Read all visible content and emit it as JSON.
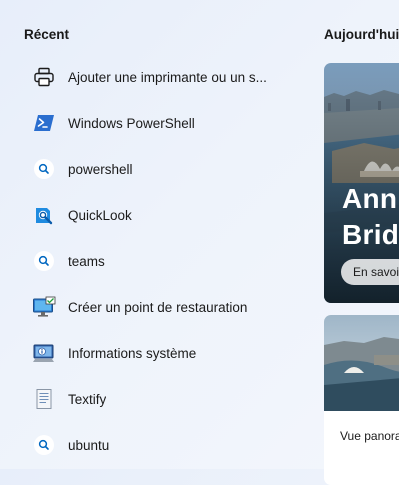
{
  "recent": {
    "title": "Récent",
    "items": [
      {
        "label": "Ajouter une imprimante ou un s...",
        "icon": "printer-icon"
      },
      {
        "label": "Windows PowerShell",
        "icon": "powershell-icon"
      },
      {
        "label": "powershell",
        "icon": "search-icon"
      },
      {
        "label": "QuickLook",
        "icon": "quicklook-icon"
      },
      {
        "label": "teams",
        "icon": "search-icon"
      },
      {
        "label": "Créer un point de restauration",
        "icon": "system-restore-icon"
      },
      {
        "label": "Informations système",
        "icon": "system-information-icon"
      },
      {
        "label": "Textify",
        "icon": "textify-icon"
      },
      {
        "label": "ubuntu",
        "icon": "search-icon"
      }
    ]
  },
  "today": {
    "title": "Aujourd'hui",
    "cards": [
      {
        "headline": "Anni\nBridg",
        "button_label": "En savoi"
      },
      {
        "caption": "Vue panora"
      }
    ]
  },
  "colors": {
    "accent_blue": "#0067c0",
    "powershell_blue": "#2a6ecf"
  }
}
